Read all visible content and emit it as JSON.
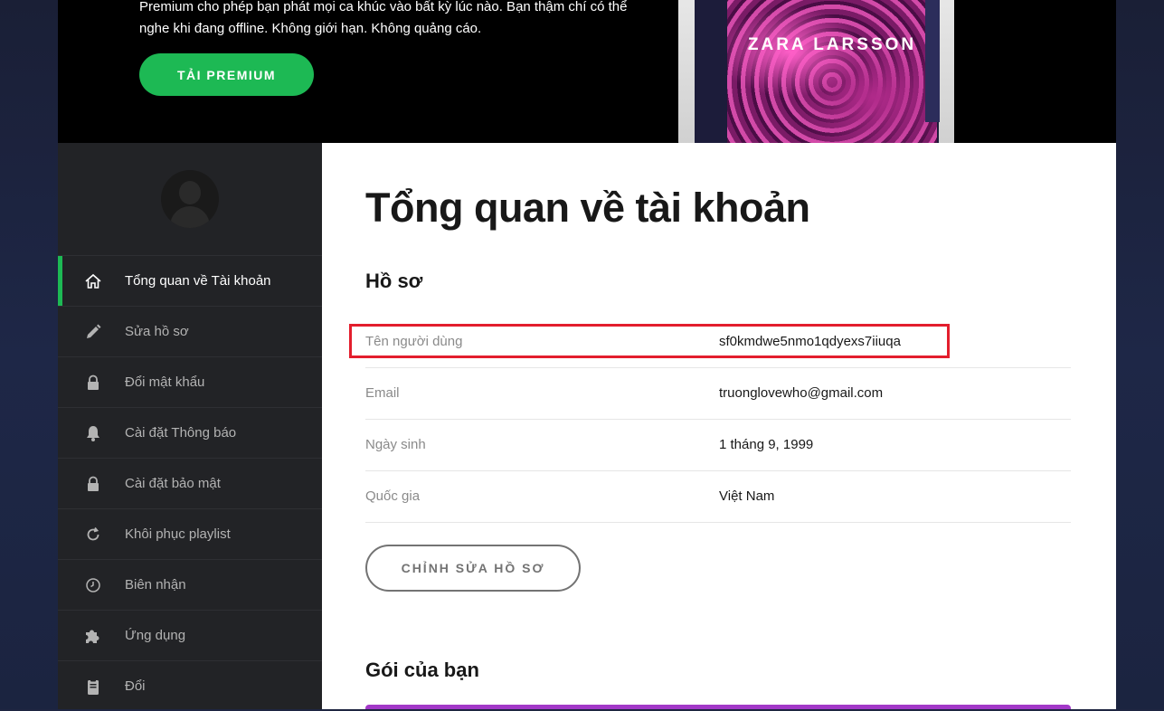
{
  "hero": {
    "text": "Premium cho phép bạn phát mọi ca khúc vào bất kỳ lúc nào. Bạn thậm chí có thể nghe khi đang offline. Không giới hạn. Không quảng cáo.",
    "button_label": "TẢI PREMIUM",
    "album_title": "ZARA LARSSON"
  },
  "sidebar": {
    "items": [
      {
        "label": "Tổng quan về Tài khoản",
        "icon": "home-icon",
        "active": true
      },
      {
        "label": "Sửa hồ sơ",
        "icon": "pencil-icon",
        "active": false
      },
      {
        "label": "Đổi mật khẩu",
        "icon": "lock-icon",
        "active": false
      },
      {
        "label": "Cài đặt Thông báo",
        "icon": "bell-icon",
        "active": false
      },
      {
        "label": "Cài đặt bảo mật",
        "icon": "lock-icon",
        "active": false
      },
      {
        "label": "Khôi phục playlist",
        "icon": "restore-icon",
        "active": false
      },
      {
        "label": "Biên nhận",
        "icon": "clock-icon",
        "active": false
      },
      {
        "label": "Ứng dụng",
        "icon": "puzzle-icon",
        "active": false
      },
      {
        "label": "Đổi",
        "icon": "clipboard-icon",
        "active": false
      }
    ]
  },
  "main": {
    "title": "Tổng quan về tài khoản",
    "profile_heading": "Hồ sơ",
    "profile": [
      {
        "key": "Tên người dùng",
        "value": "sf0kmdwe5nmo1qdyexs7iiuqa"
      },
      {
        "key": "Email",
        "value": "truonglovewho@gmail.com"
      },
      {
        "key": "Ngày sinh",
        "value": "1 tháng 9, 1999"
      },
      {
        "key": "Quốc gia",
        "value": "Việt Nam"
      }
    ],
    "edit_button": "CHỈNH SỬA HỒ SƠ",
    "plan_heading": "Gói của bạn"
  },
  "colors": {
    "accent": "#1db954",
    "highlight": "#e31e2d",
    "sidebar_bg": "#222326",
    "plan_bar": "#a238c8"
  }
}
